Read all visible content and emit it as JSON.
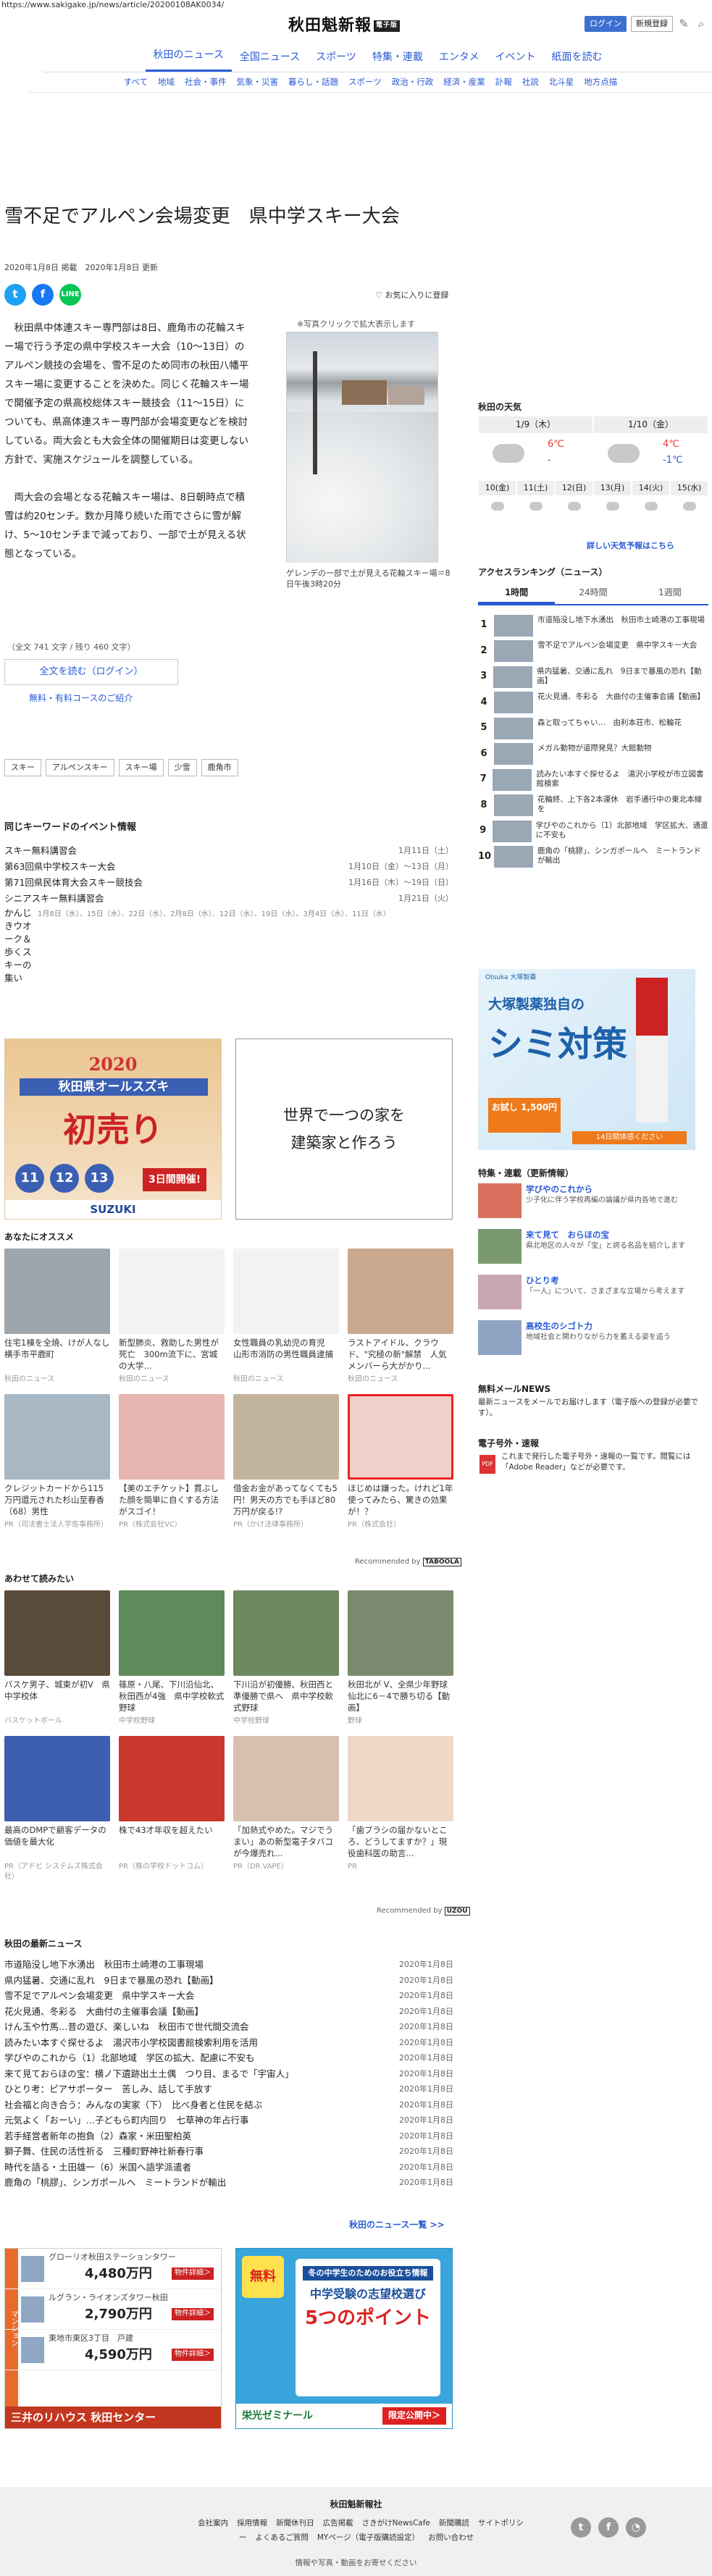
{
  "url": "https://www.sakigake.jp/news/article/20200108AK0034/",
  "header": {
    "logo": "秋田魁新報",
    "logo_tag": "電子版",
    "login": "ログイン",
    "register": "新規登録"
  },
  "nav": {
    "main": [
      "秋田のニュース",
      "全国ニュース",
      "スポーツ",
      "特集・連載",
      "エンタメ",
      "イベント",
      "紙面を読む"
    ],
    "sub": [
      "すべて",
      "地域",
      "社会・事件",
      "気象・災害",
      "暮らし・話題",
      "スポーツ",
      "政治・行政",
      "経済・産業",
      "訃報",
      "社説",
      "北斗星",
      "地方点描"
    ]
  },
  "article": {
    "title": "雪不足でアルペン会場変更　県中学スキー大会",
    "date_published": "2020年1月8日 掲載",
    "date_updated": "2020年1月8日 更新",
    "fav": "お気に入りに登録",
    "photo_note": "※写真クリックで拡大表示します",
    "caption": "ゲレンデの一部で土が見える花輪スキー場＝8日午後3時20分",
    "paragraphs": [
      "秋田県中体連スキー専門部は8日、鹿角市の花輪スキー場で行う予定の県中学校スキー大会（10～13日）のアルペン競技の会場を、雪不足のため同市の秋田八幡平スキー場に変更することを決めた。同じく花輪スキー場で開催予定の県高校総体スキー競技会（11～15日）についても、県高体連スキー専門部が会場変更などを検討している。両大会とも大会全体の開催期日は変更しない方針で、実施スケジュールを調整している。",
      "両大会の会場となる花輪スキー場は、8日朝時点で積雪は約20センチ。数か月降り続いた雨でさらに雪が解け、5～10センチまで減っており、一部で土が見える状態となっている。"
    ],
    "word_count": "（全文 741 文字 / 残り 460 文字）",
    "read_full": "全文を読む（ログイン）",
    "courses": "無料・有料コースのご紹介",
    "tags": [
      "スキー",
      "アルペンスキー",
      "スキー場",
      "少雪",
      "鹿角市"
    ]
  },
  "events": {
    "heading": "同じキーワードのイベント情報",
    "items": [
      {
        "name": "スキー無料講習会",
        "date": "1月11日（土）"
      },
      {
        "name": "第63回県中学校スキー大会",
        "date": "1月10日（金）～13日（月）"
      },
      {
        "name": "第71回県民体育大会スキー競技会",
        "date": "1月16日（木）～19日（日）"
      },
      {
        "name": "シニアスキー無料講習会",
        "date": "1月21日（火）"
      }
    ],
    "long_name": "かんじきウオーク＆歩くスキーの集い",
    "long_dates": "1月8日（水）、15日（水）、22日（水）、2月8日（水）、12日（水）、19日（水）、3月4日（水）、11日（水）"
  },
  "ads": {
    "ad1": {
      "year": "2020",
      "band": "秋田県オールスズキ",
      "big": "初売り",
      "days": [
        "11",
        "12",
        "13"
      ],
      "cta": "3日間開催!",
      "brand": "SUZUKI"
    },
    "ad2": {
      "line1": "世界で一つの家を",
      "line2": "建築家と作ろう"
    },
    "ad3": {
      "rows": [
        {
          "name": "グローリオ秋田ステーションタワー",
          "price": "4,480万円",
          "badge": "物件詳細＞"
        },
        {
          "name": "ルグラン・ライオンズタワー秋田",
          "price": "2,790万円",
          "badge": "物件詳細＞"
        },
        {
          "name": "東地市東区3丁目　戸建",
          "price": "4,590万円",
          "badge": "物件詳細＞"
        }
      ],
      "side": "マンション",
      "footer": "三井のリハウス 秋田センター"
    },
    "ad4": {
      "free": "無料",
      "a": "冬の中学生のためのお役立ち情報",
      "b": "中学受験の志望校選び",
      "c": "5つのポイント",
      "brand": "栄光ゼミナール",
      "cta": "限定公開中＞"
    },
    "ad5": {
      "brand": "Otsuka 大塚製薬",
      "title": "大塚製薬独自の",
      "big": "シミ対策",
      "price": "お試し 1,500円",
      "foot": "14日間体感ください"
    }
  },
  "recommend": {
    "heading": "あなたにオススメ",
    "cards": [
      {
        "title": "住宅1棟を全焼、けが人なし　横手市平鹿町",
        "source": "秋田のニュース",
        "color": "#9da5ad"
      },
      {
        "title": "新型肺炎、救助した男性が死亡　300m流下に、宮城の大学...",
        "source": "秋田のニュース",
        "color": "#f2f2f2"
      },
      {
        "title": "女性職員の乳幼児の育児　山形市消防の男性職員逮捕",
        "source": "秋田のニュース",
        "color": "#f2f2f2"
      },
      {
        "title": "ラストアイドル、クラウド、\"究極の新\"解禁　人気メンバーら大がかり...",
        "source": "秋田のニュース",
        "color": "#c9a88d"
      },
      {
        "title": "クレジットカードから115万円還元された杉山至春香（68）男性",
        "source": "PR（司法書士法人宇佐事務所）",
        "color": "#a7b8c4"
      },
      {
        "title": "【美のエチケット】貫ぶした顔を簡単に自くする方法がスゴイ！",
        "source": "PR（株式会社VC）",
        "color": "#e6b6b0"
      },
      {
        "title": "借金お金があってなくても5円！男天の方でも手ほど80万円が戻る!?",
        "source": "PR（かけ法律事務所）",
        "color": "#c2b49c"
      },
      {
        "title": "ほじめは嫌った。けれど1年使ってみたら、驚きの効果が！？",
        "source": "PR（株式会社）",
        "color": "#f0d0c8",
        "highlight": true
      }
    ],
    "recommended_by": "Recommended by"
  },
  "related": {
    "heading": "あわせて読みたい",
    "cards": [
      {
        "title": "バスケ男子、城東が初V　県中学校体",
        "source": "バスケットボール",
        "color": "#5a4a3a"
      },
      {
        "title": "篠原・八尾、下川沿仙北、秋田西が4強　県中学校軟式野球",
        "source": "中学校野球",
        "color": "#5f8a5a"
      },
      {
        "title": "下川沿が初優勝、秋田西と準優勝で県へ　県中学校軟式野球",
        "source": "中学校野球",
        "color": "#6e8860"
      },
      {
        "title": "秋田北が V、全県少年野球　仙北に6－4で勝ち切る【動画】",
        "source": "野球",
        "color": "#7a8a6e"
      },
      {
        "title": "最高のDMPで顧客データの価値を最大化",
        "source": "PR（アドビ システムズ株式会社）",
        "color": "#3c5fb0"
      },
      {
        "title": "株で43才年収を超えたい",
        "source": "PR（株の学校ドットコム）",
        "color": "#c9392e"
      },
      {
        "title": "「加熱式やめた。マジでうまい」あの新型電子タバコが今爆売れ...",
        "source": "PR（DR.VAPE）",
        "color": "#d7c0b0"
      },
      {
        "title": "「歯ブラシの届かないところ、どうしてますか？」現役歯科医の助言...",
        "source": "PR",
        "color": "#eed8c8"
      }
    ],
    "recommended_by": "Recommended by"
  },
  "latest": {
    "heading": "秋田の最新ニュース",
    "items": [
      {
        "title": "市道陥没し地下水湧出　秋田市土崎港の工事現場",
        "date": "2020年1月8日"
      },
      {
        "title": "県内猛暑、交通に乱れ　9日まで暴風の恐れ【動画】",
        "date": "2020年1月8日"
      },
      {
        "title": "雪不足でアルペン会場変更　県中学スキー大会",
        "date": "2020年1月8日"
      },
      {
        "title": "花火見通、冬彩る　大曲付の主催事会議【動画】",
        "date": "2020年1月8日"
      },
      {
        "title": "けん玉や竹馬…昔の遊び、楽しいね　秋田市で世代間交流会",
        "date": "2020年1月8日"
      },
      {
        "title": "読みたい本すぐ探せるよ　湯沢市小学校図書館検索利用を活用",
        "date": "2020年1月8日"
      },
      {
        "title": "学びやのこれから（1）北部地域　学区の拡大、配慮に不安も",
        "date": "2020年1月8日"
      },
      {
        "title": "来て見ておらほの宝：横ノ下遺跡出土土偶　つり目、まるで「宇宙人」",
        "date": "2020年1月8日"
      },
      {
        "title": "ひとり考：ピアサポーター　苦しみ、話して手放す",
        "date": "2020年1月8日"
      },
      {
        "title": "社会福と向き合う：みんなの実家（下）　比べ身者と住民を結ぶ",
        "date": "2020年1月8日"
      },
      {
        "title": "元気よく「おーい」…子どもら町内回り　七草神の年占行事",
        "date": "2020年1月8日"
      },
      {
        "title": "若手経営者新年の抱負（2）森家・米田聖柏英",
        "date": "2020年1月8日"
      },
      {
        "title": "獅子舞、住民の活性祈る　三種町野神社新春行事",
        "date": "2020年1月8日"
      },
      {
        "title": "時代を語る・土田雄一（6）米国へ語学派遣者",
        "date": "2020年1月8日"
      },
      {
        "title": "鹿角の「桃膠」、シンガポールへ　ミートランドが輸出",
        "date": "2020年1月8日"
      }
    ],
    "more": "秋田のニュース一覧 >>"
  },
  "sidebar": {
    "weather": {
      "heading": "秋田の天気",
      "days": [
        "1/9（木）",
        "1/10（金）"
      ],
      "highs": [
        "6℃",
        "4℃"
      ],
      "lows": [
        "-",
        "-1℃"
      ],
      "hours": [
        "10(金)",
        "11(土)",
        "12(日)",
        "13(月)",
        "14(火)",
        "15(水)"
      ],
      "more": "詳しい天気予報はこちら"
    },
    "ranking": {
      "heading": "アクセスランキング（ニュース）",
      "tabs": [
        "1時間",
        "24時間",
        "1週間"
      ],
      "items": [
        "市道陥没し地下水湧出　秋田市土崎港の工事現場",
        "雪不足でアルペン会場変更　県中学スキー大会",
        "県内猛暑、交通に乱れ　9日まで暴風の恐れ【動画】",
        "花火見通、冬彩る　大曲付の主催事会議【動画】",
        "森と取ってちゃい…　由利本荘市、松輪花",
        "メガル動物が道際発見？大館動物",
        "読みたい本すぐ探せるよ　湯沢小学校が市立図書館検索",
        "花輪終、上下各2本運休　岩手通行中の東北本線を",
        "学びやのこれから（1）北部地域　学区拡大、通還に不安も",
        "鹿角の「桃膠」、シンガポールへ　ミートランドが輸出"
      ]
    },
    "features": {
      "heading": "特集・連載（更新情報）",
      "items": [
        {
          "title": "学びやのこれから",
          "desc": "少子化に伴う学校再編の論議が県内各地で進む"
        },
        {
          "title": "来て見て　おらほの宝",
          "desc": "県北地区の人々が「宝」と誇る名品を紹介します"
        },
        {
          "title": "ひとり考",
          "desc": "「一人」について、さまざまな立場から考えます"
        },
        {
          "title": "高校生のシゴト力",
          "desc": "地域社会と関わりながら力を蓄える姿を追う"
        }
      ]
    },
    "mail": {
      "heading": "無料メールNEWS",
      "desc": "最新ニュースをメールでお届けします（電子版への登録が必要です）。"
    },
    "paper": {
      "heading": "電子号外・速報",
      "desc": "これまで発行した電子号外・速報の一覧です。閲覧には「Adobe Reader」などが必要です。"
    }
  },
  "footer": {
    "name": "秋田魁新報社",
    "links": [
      "会社案内",
      "採用情報",
      "新聞休刊日",
      "広告掲載",
      "さきがけNewsCafe",
      "新聞購読",
      "サイトポリシー",
      "よくあるご質問",
      "MYページ（電子版購読設定）",
      "お問い合わせ"
    ],
    "copy": "情報や写真・動画をお寄せください"
  }
}
